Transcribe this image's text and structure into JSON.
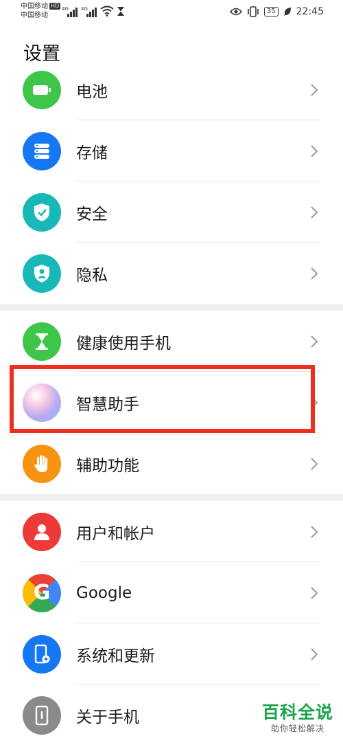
{
  "status_bar": {
    "carrier_1": "中国移动",
    "hd_badge": "HD",
    "carrier_2": "中国移动",
    "network_1": "4G",
    "network_2": "4G",
    "battery_level": "35",
    "time": "22:45"
  },
  "page_title": "设置",
  "items": [
    {
      "label": "电池",
      "icon": "battery-icon",
      "color": "#3ec64a"
    },
    {
      "label": "存储",
      "icon": "storage-icon",
      "color": "#1677f2"
    },
    {
      "label": "安全",
      "icon": "shield-icon",
      "color": "#19b8b8"
    },
    {
      "label": "隐私",
      "icon": "privacy-icon",
      "color": "#19b8b8"
    },
    {
      "label": "健康使用手机",
      "icon": "hourglass-icon",
      "color": "#3ec64a"
    },
    {
      "label": "智慧助手",
      "icon": "assistant-orb-icon",
      "color": "#b9a8f0"
    },
    {
      "label": "辅助功能",
      "icon": "hand-icon",
      "color": "#f7930e"
    },
    {
      "label": "用户和帐户",
      "icon": "user-icon",
      "color": "#ee3939"
    },
    {
      "label": "Google",
      "icon": "google-icon",
      "color": "#4285f4"
    },
    {
      "label": "系统和更新",
      "icon": "system-update-icon",
      "color": "#1677f2"
    },
    {
      "label": "关于手机",
      "icon": "phone-info-icon",
      "color": "#8a8a8a"
    }
  ],
  "watermark": {
    "main": "百科全说",
    "sub": "助你轻松解决"
  }
}
